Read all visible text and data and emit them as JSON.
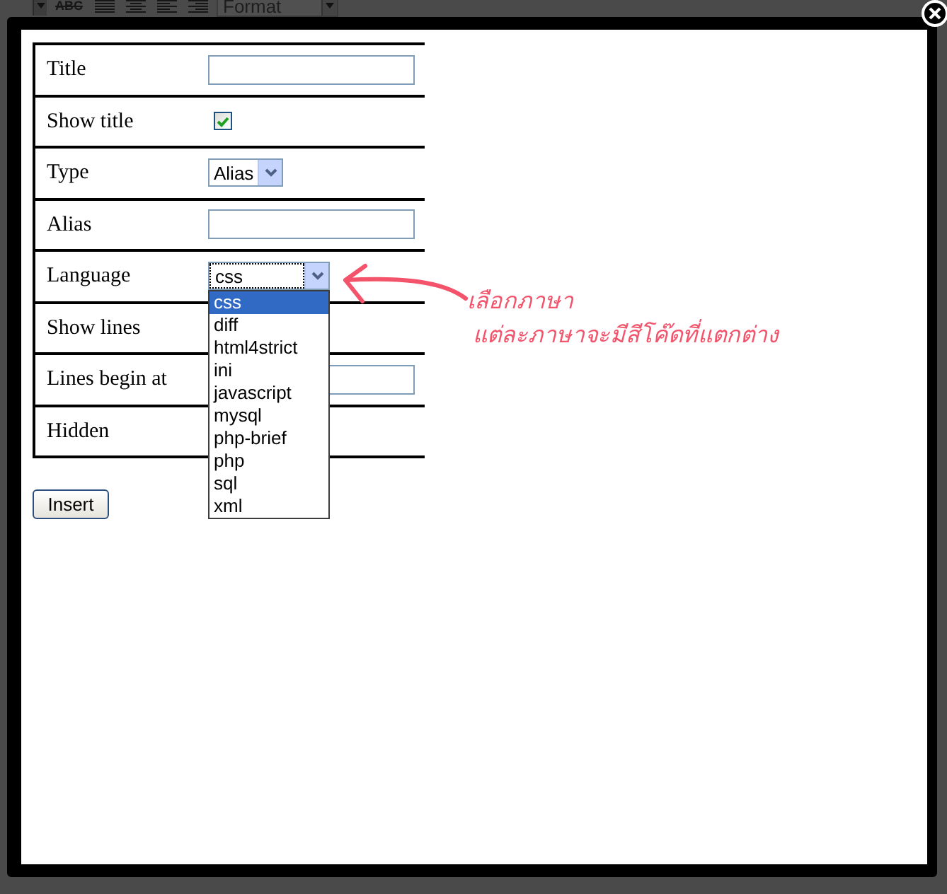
{
  "editor_toolbar": {
    "strikethrough_label": "ABC",
    "format_select": "Format"
  },
  "dialog": {
    "rows": [
      {
        "kind": "text",
        "label": "Title"
      },
      {
        "kind": "checkbox",
        "label": "Show title",
        "checked": true
      },
      {
        "kind": "select",
        "label": "Type",
        "value": "Alias",
        "open": false
      },
      {
        "kind": "text",
        "label": "Alias"
      },
      {
        "kind": "select",
        "label": "Language",
        "value": "css",
        "open": true,
        "options": [
          {
            "label": "css",
            "selected": true
          },
          {
            "label": "diff",
            "selected": false
          },
          {
            "label": "html4strict",
            "selected": false
          },
          {
            "label": "ini",
            "selected": false
          },
          {
            "label": "javascript",
            "selected": false
          },
          {
            "label": "mysql",
            "selected": false
          },
          {
            "label": "php-brief",
            "selected": false
          },
          {
            "label": "php",
            "selected": false
          },
          {
            "label": "sql",
            "selected": false
          },
          {
            "label": "xml",
            "selected": false
          }
        ]
      },
      {
        "kind": "label",
        "label": "Show lines"
      },
      {
        "kind": "text",
        "label": "Lines begin at"
      },
      {
        "kind": "label",
        "label": "Hidden"
      }
    ],
    "insert_button": "Insert"
  },
  "annotation": {
    "lines": [
      "เลือกภาษา",
      "แต่ละภาษาจะมีสีโค๊ดที่แตกต่าง"
    ]
  }
}
